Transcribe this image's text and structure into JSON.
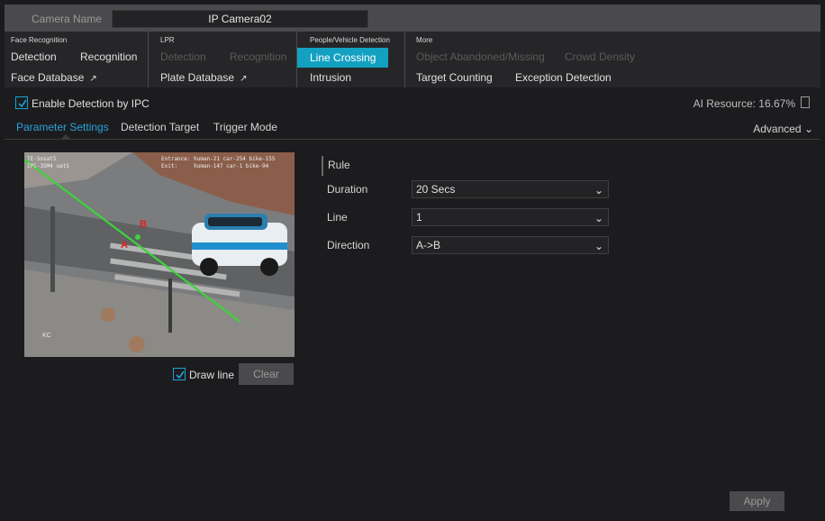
{
  "camera": {
    "label": "Camera Name",
    "value": "IP Camera02"
  },
  "categories": [
    {
      "head": "Face Recognition",
      "items": [
        "Detection",
        "Recognition",
        "Face Database"
      ]
    },
    {
      "head": "LPR",
      "items": [
        "Detection",
        "Recognition",
        "Plate Database"
      ]
    },
    {
      "head": "People/Vehicle Detection",
      "items": [
        "Line Crossing",
        "Intrusion"
      ]
    },
    {
      "head": "More",
      "items": [
        "Object Abandoned/Missing",
        "Crowd Density",
        "Target Counting",
        "Exception Detection"
      ]
    }
  ],
  "enable": {
    "label": "Enable Detection by IPC",
    "checked": true
  },
  "ai_resource": "AI Resource: 16.67%",
  "subtabs": [
    "Parameter Settings",
    "Detection Target",
    "Trigger Mode"
  ],
  "advanced": "Advanced",
  "video": {
    "overlay_left_1": "TE-Sosat5",
    "overlay_left_2": "IPC-35M4 uat5",
    "overlay_right_1": "Entrance: human-21 car-254 bike-155",
    "overlay_right_2": "Exit:     human-147 car-1 bike-94",
    "point_a": "A",
    "point_b": "B",
    "corner": "KC"
  },
  "drawline": {
    "label": "Draw line",
    "checked": true
  },
  "clear_label": "Clear",
  "rule": {
    "title": "Rule",
    "fields": [
      {
        "label": "Duration",
        "value": "20 Secs"
      },
      {
        "label": "Line",
        "value": "1"
      },
      {
        "label": "Direction",
        "value": "A->B"
      }
    ]
  },
  "apply_label": "Apply",
  "colors": {
    "accent": "#13a1c1",
    "line": "#3fd23a"
  }
}
